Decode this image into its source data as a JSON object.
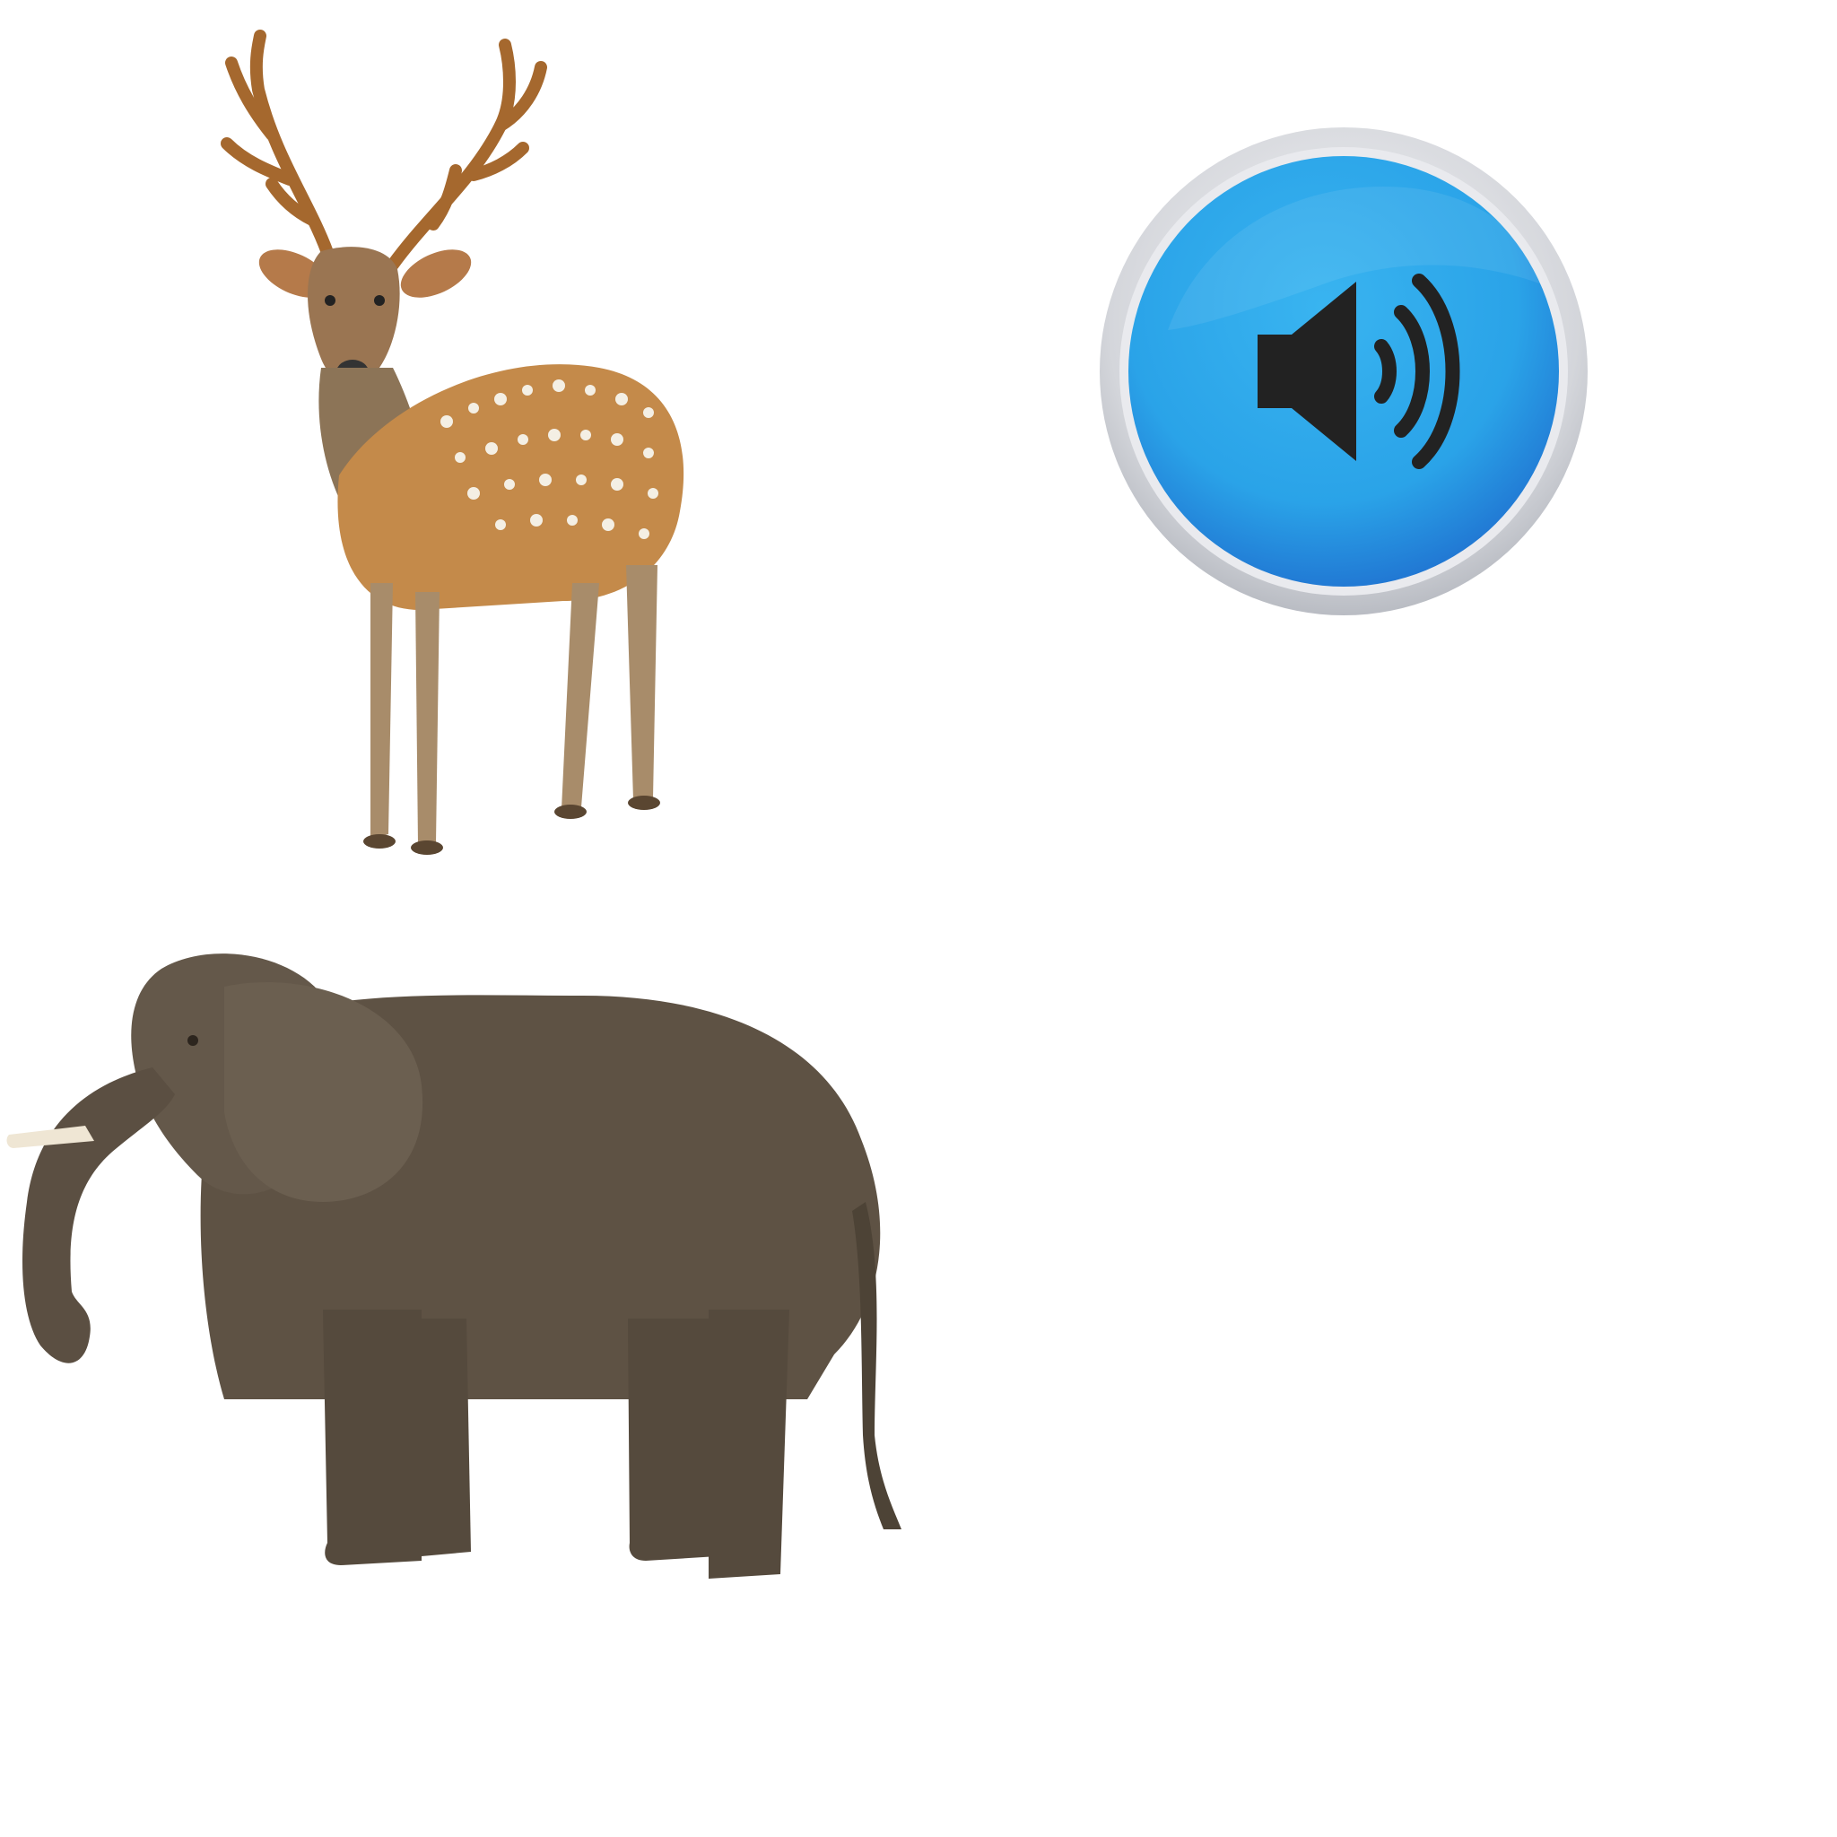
{
  "scene": {
    "background": "#ffffff",
    "images": [
      {
        "name": "spotted deer",
        "icon": "deer-picture"
      },
      {
        "name": "elephant",
        "icon": "elephant-picture"
      }
    ]
  },
  "sound_button": {
    "icon": "speaker-volume-icon",
    "colors": {
      "fill": "#2aa3e8",
      "fill_dark": "#1f6fcf",
      "ring": "#d9dbe0",
      "glyph": "#222222"
    }
  }
}
